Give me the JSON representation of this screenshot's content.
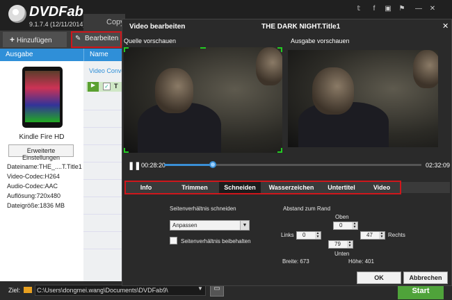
{
  "app": {
    "name": "DVDFab",
    "version": "9.1.7.4 (12/11/2014)",
    "top_tab": "Copy"
  },
  "top_icons": [
    "twitter-icon",
    "facebook-icon",
    "youtube-icon",
    "flag-icon",
    "minimize-icon",
    "close-icon"
  ],
  "toolbar": {
    "add_label": "Hinzufügen",
    "edit_label": "Bearbeiten"
  },
  "columns": {
    "ausgabe": "Ausgabe",
    "name": "Name"
  },
  "device": {
    "name": "Kindle Fire HD",
    "advanced_button": "Erweiterte Einstellungen",
    "info": [
      "Dateiname:THE_....T.Title1",
      "Video-Codec:H264",
      "Audio-Codec:AAC",
      "Auflösung:720x480",
      "Dateigröße:1836 MB"
    ]
  },
  "middle": {
    "header": "Video Conve",
    "row_text": "T"
  },
  "dialog": {
    "title": "Video bearbeiten",
    "movie_title": "THE DARK NIGHT.Title1",
    "source_label": "Quelle vorschauen",
    "output_label": "Ausgabe vorschauen",
    "player": {
      "current_time": "00:28:20",
      "total_time": "02:32:09",
      "progress": 0.19
    },
    "tabs": [
      "Info",
      "Trimmen",
      "Schneiden",
      "Wasserzeichen",
      "Untertitel",
      "Video"
    ],
    "active_tab": "Schneiden",
    "crop": {
      "ratio_label": "Seitenverhältnis schneiden",
      "ratio_value": "Anpassen",
      "keep_ratio_label": "Seitenverhältnis beibehalten",
      "margin_label": "Abstand zum Rand",
      "top_label": "Oben",
      "top": "0",
      "left_label": "Links",
      "left": "0",
      "right_label": "Rechts",
      "right": "47",
      "bottom_label": "Unten",
      "bottom": "79",
      "width_label": "Breite: 673",
      "height_label": "Höhe: 401"
    },
    "ok": "OK",
    "cancel": "Abbrechen"
  },
  "bottom": {
    "ziel_label": "Ziel:",
    "path": "C:\\Users\\dongmei.wang\\Documents\\DVDFab9\\",
    "start": "Start"
  }
}
